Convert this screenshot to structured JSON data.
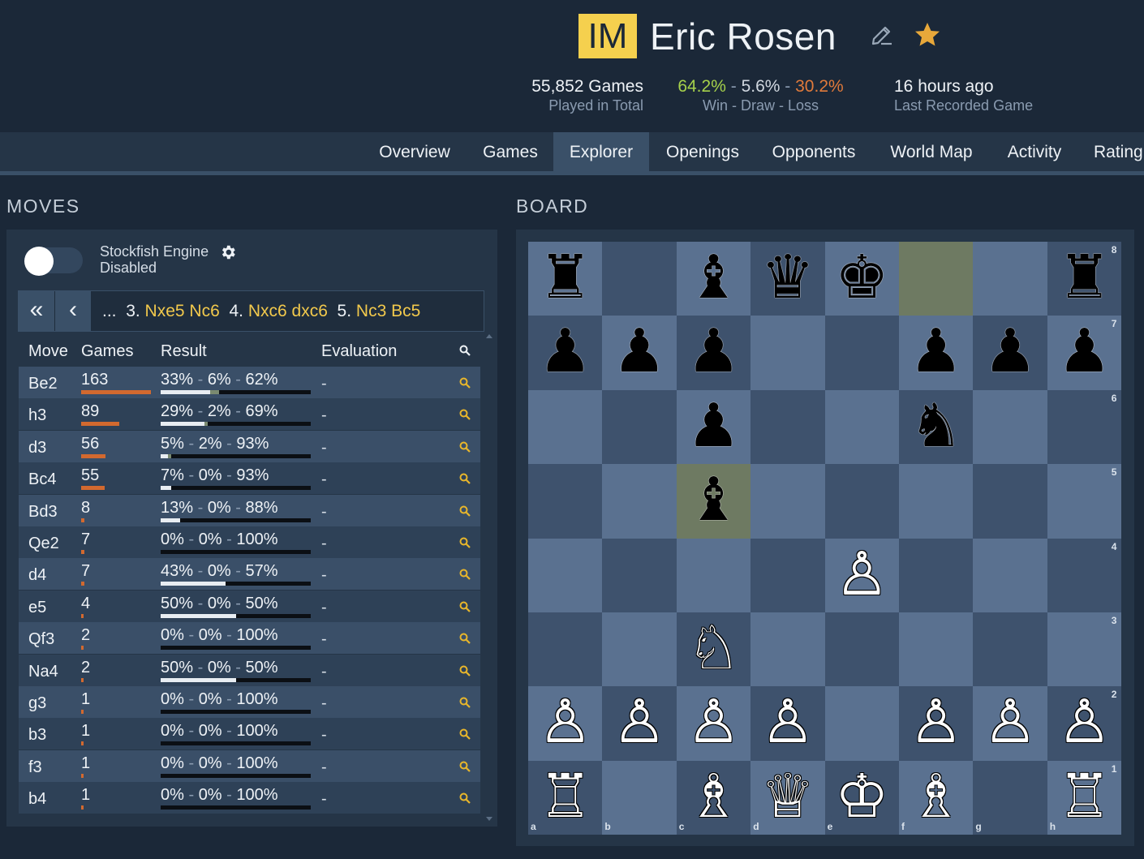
{
  "profile": {
    "title": "IM",
    "name": "Eric Rosen",
    "games_count": "55,852 Games",
    "games_label": "Played in Total",
    "win": "64.2%",
    "draw": "5.6%",
    "loss": "30.2%",
    "wdl_sep": "-",
    "wdl_label": "Win - Draw - Loss",
    "last_game": "16 hours ago",
    "last_game_label": "Last Recorded Game"
  },
  "nav": {
    "tabs": [
      "Overview",
      "Games",
      "Explorer",
      "Openings",
      "Opponents",
      "World Map",
      "Activity",
      "Rating"
    ],
    "active": "Explorer"
  },
  "moves_section": {
    "title": "MOVES",
    "engine_label": "Stockfish Engine",
    "engine_status": "Disabled",
    "first_button": "«",
    "prev_button": "‹",
    "sequence": {
      "ellipsis": "...",
      "n3": "3.",
      "m3a": "Nxe5",
      "m3b": "Nc6",
      "n4": "4.",
      "m4a": "Nxc6",
      "m4b": "dxc6",
      "n5": "5.",
      "m5a": "Nc3",
      "m5b": "Bc5"
    },
    "headers": {
      "move": "Move",
      "games": "Games",
      "result": "Result",
      "evaluation": "Evaluation"
    },
    "rows": [
      {
        "move": "Be2",
        "games": "163",
        "games_frac": 1.0,
        "w": "33%",
        "d": "6%",
        "l": "62%",
        "wf": 0.33,
        "df": 0.06,
        "eval": "-"
      },
      {
        "move": "h3",
        "games": "89",
        "games_frac": 0.546,
        "w": "29%",
        "d": "2%",
        "l": "69%",
        "wf": 0.29,
        "df": 0.02,
        "eval": "-"
      },
      {
        "move": "d3",
        "games": "56",
        "games_frac": 0.344,
        "w": "5%",
        "d": "2%",
        "l": "93%",
        "wf": 0.05,
        "df": 0.02,
        "eval": "-"
      },
      {
        "move": "Bc4",
        "games": "55",
        "games_frac": 0.337,
        "w": "7%",
        "d": "0%",
        "l": "93%",
        "wf": 0.07,
        "df": 0.0,
        "eval": "-"
      },
      {
        "move": "Bd3",
        "games": "8",
        "games_frac": 0.049,
        "w": "13%",
        "d": "0%",
        "l": "88%",
        "wf": 0.13,
        "df": 0.0,
        "eval": "-"
      },
      {
        "move": "Qe2",
        "games": "7",
        "games_frac": 0.043,
        "w": "0%",
        "d": "0%",
        "l": "100%",
        "wf": 0.0,
        "df": 0.0,
        "eval": "-"
      },
      {
        "move": "d4",
        "games": "7",
        "games_frac": 0.043,
        "w": "43%",
        "d": "0%",
        "l": "57%",
        "wf": 0.43,
        "df": 0.0,
        "eval": "-"
      },
      {
        "move": "e5",
        "games": "4",
        "games_frac": 0.025,
        "w": "50%",
        "d": "0%",
        "l": "50%",
        "wf": 0.5,
        "df": 0.0,
        "eval": "-"
      },
      {
        "move": "Qf3",
        "games": "2",
        "games_frac": 0.012,
        "w": "0%",
        "d": "0%",
        "l": "100%",
        "wf": 0.0,
        "df": 0.0,
        "eval": "-"
      },
      {
        "move": "Na4",
        "games": "2",
        "games_frac": 0.012,
        "w": "50%",
        "d": "0%",
        "l": "50%",
        "wf": 0.5,
        "df": 0.0,
        "eval": "-"
      },
      {
        "move": "g3",
        "games": "1",
        "games_frac": 0.006,
        "w": "0%",
        "d": "0%",
        "l": "100%",
        "wf": 0.0,
        "df": 0.0,
        "eval": "-"
      },
      {
        "move": "b3",
        "games": "1",
        "games_frac": 0.006,
        "w": "0%",
        "d": "0%",
        "l": "100%",
        "wf": 0.0,
        "df": 0.0,
        "eval": "-"
      },
      {
        "move": "f3",
        "games": "1",
        "games_frac": 0.006,
        "w": "0%",
        "d": "0%",
        "l": "100%",
        "wf": 0.0,
        "df": 0.0,
        "eval": "-"
      },
      {
        "move": "b4",
        "games": "1",
        "games_frac": 0.006,
        "w": "0%",
        "d": "0%",
        "l": "100%",
        "wf": 0.0,
        "df": 0.0,
        "eval": "-"
      }
    ]
  },
  "board_section": {
    "title": "BOARD",
    "files": [
      "a",
      "b",
      "c",
      "d",
      "e",
      "f",
      "g",
      "h"
    ],
    "ranks": [
      "8",
      "7",
      "6",
      "5",
      "4",
      "3",
      "2",
      "1"
    ],
    "highlight": [
      "f8",
      "c5"
    ],
    "pieces": [
      {
        "sq": "a8",
        "glyph": "♜",
        "color": "black"
      },
      {
        "sq": "c8",
        "glyph": "♝",
        "color": "black"
      },
      {
        "sq": "d8",
        "glyph": "♛",
        "color": "black"
      },
      {
        "sq": "e8",
        "glyph": "♚",
        "color": "black"
      },
      {
        "sq": "h8",
        "glyph": "♜",
        "color": "black"
      },
      {
        "sq": "a7",
        "glyph": "♟",
        "color": "black"
      },
      {
        "sq": "b7",
        "glyph": "♟",
        "color": "black"
      },
      {
        "sq": "c7",
        "glyph": "♟",
        "color": "black"
      },
      {
        "sq": "f7",
        "glyph": "♟",
        "color": "black"
      },
      {
        "sq": "g7",
        "glyph": "♟",
        "color": "black"
      },
      {
        "sq": "h7",
        "glyph": "♟",
        "color": "black"
      },
      {
        "sq": "c6",
        "glyph": "♟",
        "color": "black"
      },
      {
        "sq": "f6",
        "glyph": "♞",
        "color": "black"
      },
      {
        "sq": "c5",
        "glyph": "♝",
        "color": "black"
      },
      {
        "sq": "e4",
        "glyph": "♙",
        "color": "white"
      },
      {
        "sq": "c3",
        "glyph": "♘",
        "color": "white"
      },
      {
        "sq": "a2",
        "glyph": "♙",
        "color": "white"
      },
      {
        "sq": "b2",
        "glyph": "♙",
        "color": "white"
      },
      {
        "sq": "c2",
        "glyph": "♙",
        "color": "white"
      },
      {
        "sq": "d2",
        "glyph": "♙",
        "color": "white"
      },
      {
        "sq": "f2",
        "glyph": "♙",
        "color": "white"
      },
      {
        "sq": "g2",
        "glyph": "♙",
        "color": "white"
      },
      {
        "sq": "h2",
        "glyph": "♙",
        "color": "white"
      },
      {
        "sq": "a1",
        "glyph": "♖",
        "color": "white"
      },
      {
        "sq": "c1",
        "glyph": "♗",
        "color": "white"
      },
      {
        "sq": "d1",
        "glyph": "♕",
        "color": "white"
      },
      {
        "sq": "e1",
        "glyph": "♔",
        "color": "white"
      },
      {
        "sq": "f1",
        "glyph": "♗",
        "color": "white"
      },
      {
        "sq": "h1",
        "glyph": "♖",
        "color": "white"
      }
    ]
  },
  "icons": {
    "edit": "pencil-edit-icon",
    "favorite": "star-icon",
    "settings": "gear-icon",
    "search": "search-icon"
  },
  "colors": {
    "title_badge": "#f5d04e",
    "win": "#a6d14b",
    "loss": "#e07a3b",
    "move_highlight": "#f2c94c",
    "games_bar": "#d2692f",
    "star": "#e8a83a"
  }
}
